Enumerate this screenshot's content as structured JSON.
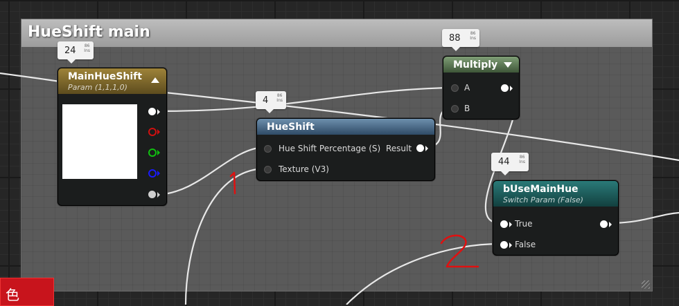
{
  "comment": {
    "title": "HueShift main"
  },
  "stat_bubbles": {
    "param": "24",
    "hueshift": "4",
    "multiply": "88",
    "switch": "44",
    "unit_top": "86",
    "unit_bottom": "Ins"
  },
  "nodes": {
    "main_hue_shift": {
      "title": "MainHueShift",
      "subtitle": "Param (1,1,1,0)"
    },
    "multiply": {
      "title": "Multiply",
      "pin_a": "A",
      "pin_b": "B"
    },
    "hueshift": {
      "title": "HueShift",
      "pin_percent": "Hue Shift Percentage (S)",
      "pin_texture": "Texture (V3)",
      "pin_result": "Result"
    },
    "use_main_hue": {
      "title": "bUseMainHue",
      "subtitle": "Switch Param (False)",
      "pin_true": "True",
      "pin_false": "False"
    }
  },
  "ime_indicator": {
    "text": "色"
  },
  "colors": {
    "pin_red": "#d01010",
    "pin_green": "#10c010",
    "pin_blue": "#1a1aff",
    "annotation_red": "#e01010",
    "ime_red": "#c8141c"
  }
}
